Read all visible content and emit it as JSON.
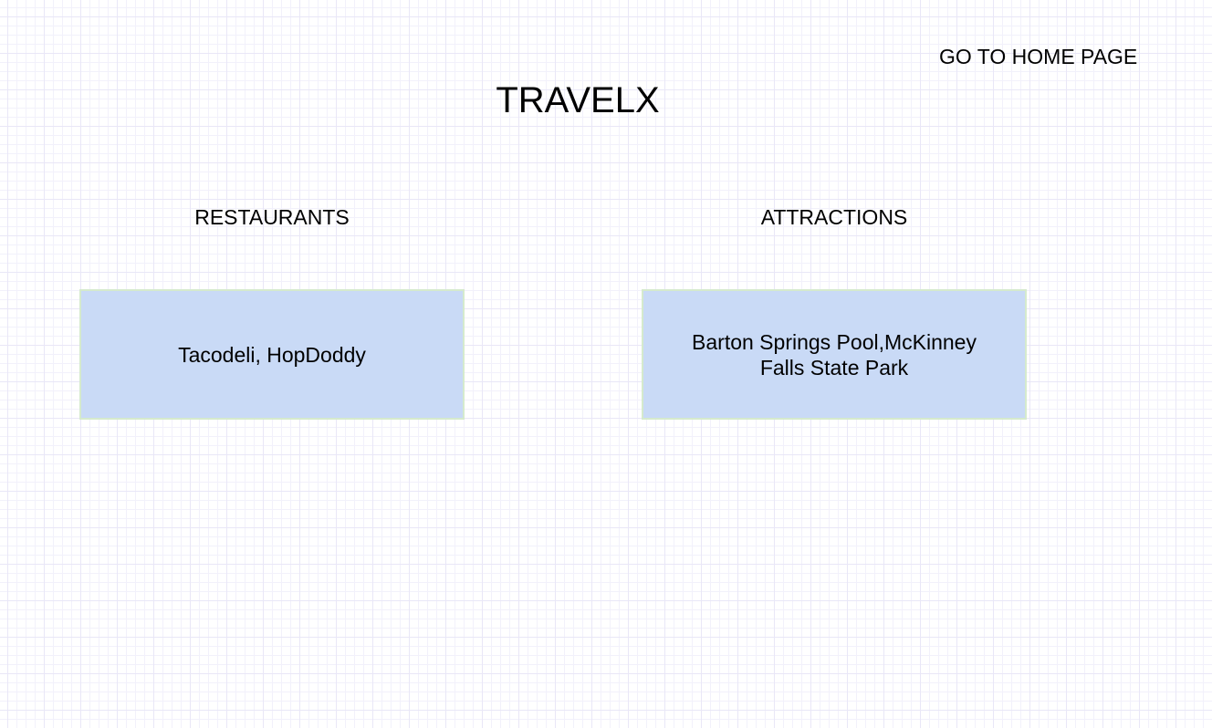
{
  "nav": {
    "home_link": "GO TO HOME PAGE"
  },
  "header": {
    "title": "TRAVELX"
  },
  "sections": {
    "restaurants": {
      "heading": "RESTAURANTS",
      "content": "Tacodeli, HopDoddy"
    },
    "attractions": {
      "heading": "ATTRACTIONS",
      "content": "Barton Springs Pool,McKinney Falls State Park"
    }
  },
  "colors": {
    "card_fill": "#c9daf6",
    "card_border": "#d5eacd",
    "grid_line": "#e9e7f7"
  }
}
